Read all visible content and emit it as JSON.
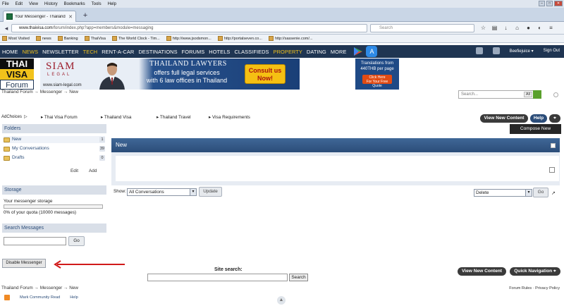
{
  "browser": {
    "menu": [
      "File",
      "Edit",
      "View",
      "History",
      "Bookmarks",
      "Tools",
      "Help"
    ],
    "tab_title": "Your Messenger - Thailand Fo...",
    "url_host": "www.thaivisa.com",
    "url_rest": "/forum/index.php?app=members&module=messaging",
    "search_placeholder": "Search",
    "bookmarks": [
      "Most Visited",
      "news",
      "Banking",
      "ThaiVisa",
      "The World Clock - Tim...",
      "http://www.jsodsmon...",
      "http://portalseven.co...",
      "http://sassenie.com/..."
    ]
  },
  "sitenav": {
    "items": [
      "Home",
      "News",
      "Newsletter",
      "Tech",
      "Rent-A-Car",
      "Destinations",
      "Forums",
      "Hotels",
      "Classifieds",
      "Property",
      "Dating",
      "More"
    ],
    "highlighted": [
      "News",
      "Tech",
      "Property"
    ],
    "user": "Beefiejuice",
    "sign_out": "Sign Out"
  },
  "logo": {
    "line1": "THAI",
    "line2": "VISA",
    "line3": "Forum"
  },
  "ad_banner": {
    "brand": "SIAM",
    "brand_sub": "LEGAL",
    "url": "www.siam-legal.com",
    "headline": "THAILAND LAWYERS",
    "body_line1": "offers full legal services",
    "body_line2": "with 6 law offices in Thailand",
    "cta_line1": "Consult us",
    "cta_line2": "Now!"
  },
  "ad_small": {
    "line1": "Translations from",
    "line2": "440THB per page",
    "cta_line1": "Click Here",
    "cta_line2": "For Your Free Quote"
  },
  "search": {
    "placeholder": "Search...",
    "scope": "All"
  },
  "breadcrumb": {
    "text": "Thailand Forum  →  Messenger  →  New"
  },
  "adchoices": {
    "label": "AdChoices",
    "links": [
      "Thai Visa Forum",
      "Thailand Visa",
      "Thailand Travel",
      "Visa Requirements"
    ]
  },
  "actions": {
    "view_new": "View New Content",
    "help": "Help",
    "compose": "Compose New",
    "quick_nav": "Quick Navigation"
  },
  "sidebar": {
    "folders_title": "Folders",
    "folders": [
      {
        "name": "New",
        "count": "1"
      },
      {
        "name": "My Conversations",
        "count": "39"
      },
      {
        "name": "Drafts",
        "count": "0"
      }
    ],
    "edit": "Edit",
    "add": "Add",
    "storage_title": "Storage",
    "storage_label": "Your messenger storage",
    "storage_pct": 0,
    "storage_quota": "0% of your quota (10000 messages)",
    "search_title": "Search Messages",
    "search_go": "Go",
    "disable": "Disable Messenger"
  },
  "main": {
    "panel_title": "New",
    "show_label": "Show:",
    "show_value": "All Conversations",
    "update": "Update",
    "action_value": "Delete",
    "action_go": "Go"
  },
  "bottom": {
    "site_search_label": "Site search:",
    "search_button": "Search",
    "forum_rules": "Forum Rules · Privacy Policy",
    "mark_read": "Mark Community Read",
    "help": "Help"
  },
  "colors": {
    "nav_bg": "#1f3552",
    "nav_highlight": "#f2c21b",
    "panel_blue": "#2c4d79",
    "annotation_arrow": "#d11a1a"
  }
}
